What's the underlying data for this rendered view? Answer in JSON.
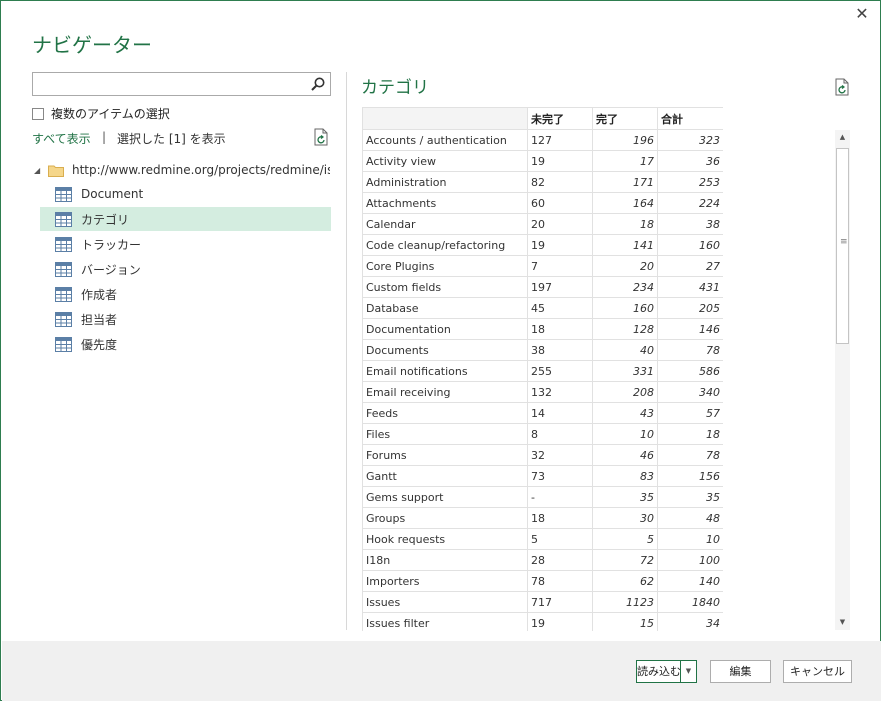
{
  "window": {
    "title": "ナビゲーター",
    "close_glyph": "✕"
  },
  "left": {
    "search": {
      "value": "",
      "placeholder": ""
    },
    "multi_select_label": "複数のアイテムの選択",
    "show_all": "すべて表示",
    "separator": "|",
    "show_selected": "選択した [1] を表示",
    "tree": {
      "root_label": "http://www.redmine.org/projects/redmine/issu...",
      "items": [
        {
          "label": "Document",
          "selected": false
        },
        {
          "label": "カテゴリ",
          "selected": true
        },
        {
          "label": "トラッカー",
          "selected": false
        },
        {
          "label": "バージョン",
          "selected": false
        },
        {
          "label": "作成者",
          "selected": false
        },
        {
          "label": "担当者",
          "selected": false
        },
        {
          "label": "優先度",
          "selected": false
        }
      ]
    }
  },
  "preview": {
    "title": "カテゴリ",
    "columns": [
      "",
      "未完了",
      "完了",
      "合計"
    ],
    "rows": [
      [
        "Accounts / authentication",
        "127",
        "196",
        "323"
      ],
      [
        "Activity view",
        "19",
        "17",
        "36"
      ],
      [
        "Administration",
        "82",
        "171",
        "253"
      ],
      [
        "Attachments",
        "60",
        "164",
        "224"
      ],
      [
        "Calendar",
        "20",
        "18",
        "38"
      ],
      [
        "Code cleanup/refactoring",
        "19",
        "141",
        "160"
      ],
      [
        "Core Plugins",
        "7",
        "20",
        "27"
      ],
      [
        "Custom fields",
        "197",
        "234",
        "431"
      ],
      [
        "Database",
        "45",
        "160",
        "205"
      ],
      [
        "Documentation",
        "18",
        "128",
        "146"
      ],
      [
        "Documents",
        "38",
        "40",
        "78"
      ],
      [
        "Email notifications",
        "255",
        "331",
        "586"
      ],
      [
        "Email receiving",
        "132",
        "208",
        "340"
      ],
      [
        "Feeds",
        "14",
        "43",
        "57"
      ],
      [
        "Files",
        "8",
        "10",
        "18"
      ],
      [
        "Forums",
        "32",
        "46",
        "78"
      ],
      [
        "Gantt",
        "73",
        "83",
        "156"
      ],
      [
        "Gems support",
        "-",
        "35",
        "35"
      ],
      [
        "Groups",
        "18",
        "30",
        "48"
      ],
      [
        "Hook requests",
        "5",
        "5",
        "10"
      ],
      [
        "I18n",
        "28",
        "72",
        "100"
      ],
      [
        "Importers",
        "78",
        "62",
        "140"
      ],
      [
        "Issues",
        "717",
        "1123",
        "1840"
      ],
      [
        "Issues filter",
        "19",
        "15",
        "34"
      ]
    ]
  },
  "footer": {
    "load_label": "読み込む",
    "edit_label": "編集",
    "cancel_label": "キャンセル"
  },
  "colors": {
    "accent": "#217346",
    "selection": "#d4ede0",
    "footer_bg": "#f0f0f0"
  },
  "icons": {
    "search": "search-icon",
    "refresh": "refresh-document-icon",
    "folder": "folder-icon",
    "table": "table-icon",
    "close": "close-icon"
  }
}
